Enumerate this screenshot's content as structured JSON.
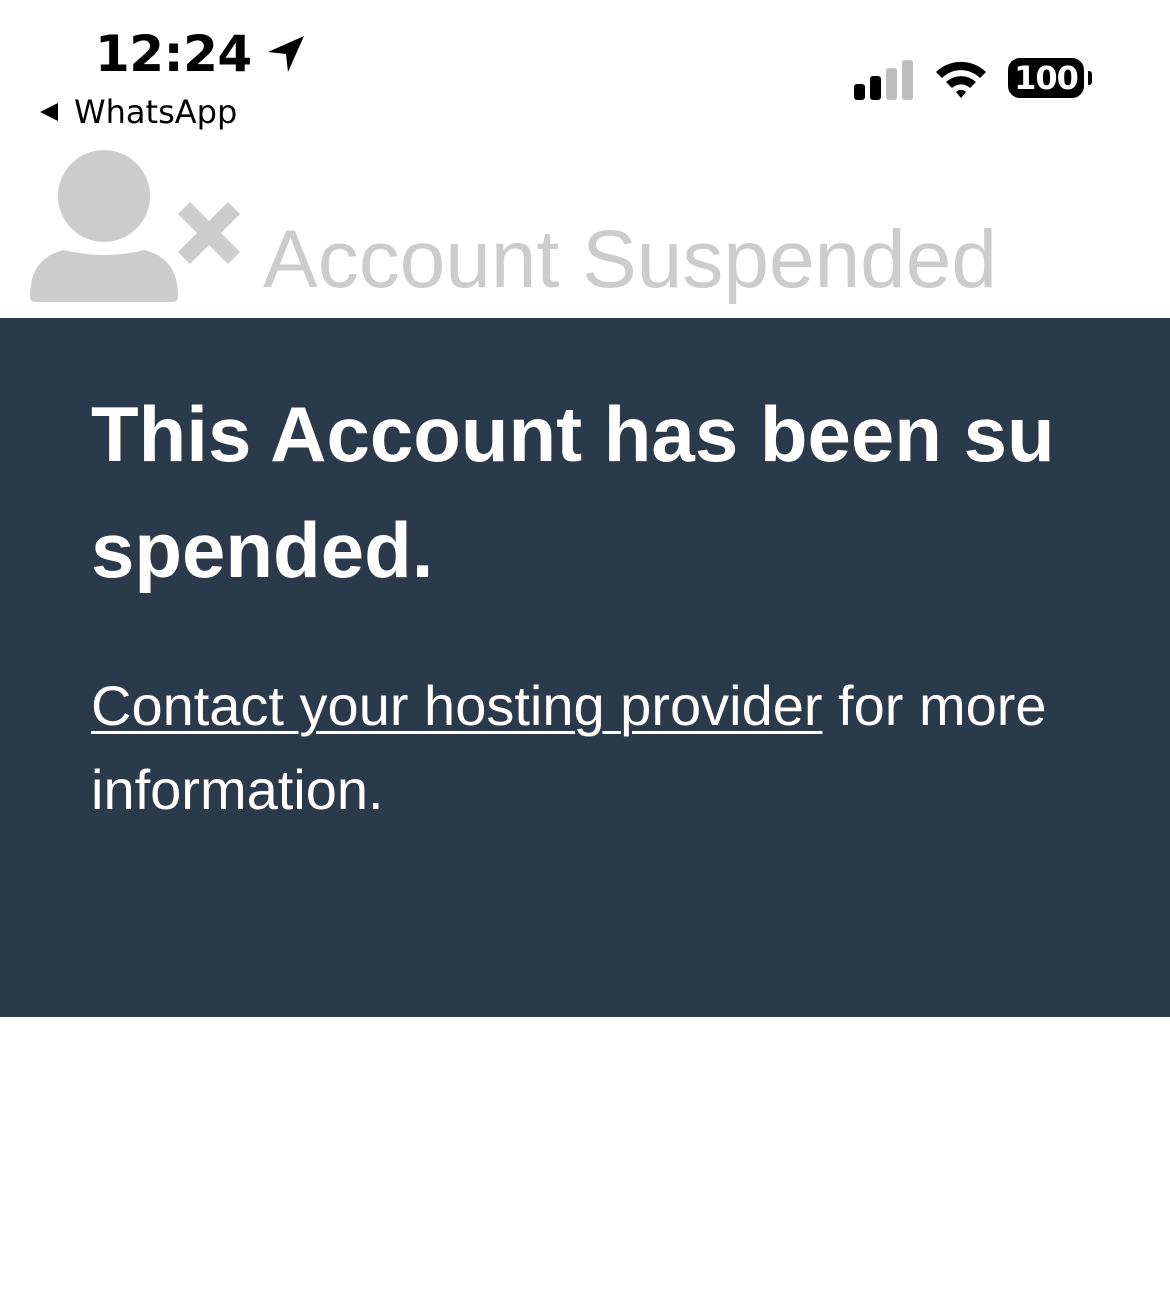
{
  "status_bar": {
    "time": "12:24",
    "back_label": "WhatsApp",
    "battery_level": "100",
    "icons": [
      "location-arrow-icon",
      "back-arrow-icon",
      "cellular-signal-icon",
      "wifi-icon",
      "battery-icon"
    ],
    "signal_bars_active": 2,
    "signal_bars_total": 4
  },
  "header": {
    "title": "Account Suspended",
    "icon": "user-x-icon",
    "icon_color": "#cccccc"
  },
  "panel": {
    "heading": "This Account has been suspended.",
    "link_text": "Contact your hosting provider",
    "text_after_link": " for more information.",
    "background_color": "#2b3a4a",
    "text_color": "#ffffff"
  }
}
